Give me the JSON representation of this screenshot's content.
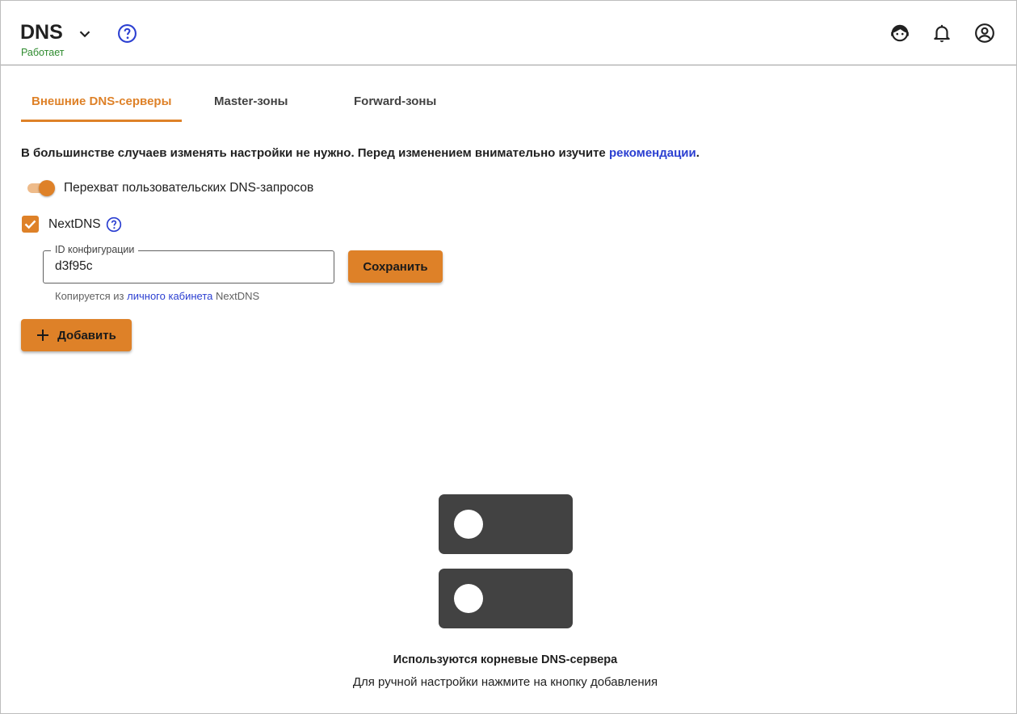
{
  "header": {
    "title": "DNS",
    "status": "Работает",
    "status_color": "#2e8b2e"
  },
  "tabs": [
    {
      "label": "Внешние DNS-серверы",
      "active": true
    },
    {
      "label": "Master-зоны",
      "active": false
    },
    {
      "label": "Forward-зоны",
      "active": false
    }
  ],
  "notice": {
    "text": "В большинстве случаев изменять настройки не нужно. Перед изменением внимательно изучите ",
    "link": "рекомендации",
    "end": "."
  },
  "intercept": {
    "label": "Перехват пользовательских DNS-запросов",
    "enabled": true
  },
  "nextdns": {
    "label": "NextDNS",
    "checked": true,
    "field_label": "ID конфигурации",
    "field_value": "d3f95c",
    "helper_prefix": "Копируется из ",
    "helper_link": "личного кабинета",
    "helper_suffix": " NextDNS",
    "save_label": "Сохранить"
  },
  "add_label": "Добавить",
  "empty_state": {
    "title": "Используются корневые DNS-сервера",
    "subtitle": "Для ручной настройки нажмите на кнопку добавления"
  },
  "icons": {
    "dropdown": "chevron-down-icon",
    "help": "help-circle-icon",
    "support": "support-agent-icon",
    "notifications": "bell-icon",
    "account": "account-circle-icon",
    "server": "server-icon"
  },
  "colors": {
    "accent": "#de8128",
    "link": "#2b3fd1",
    "help_icon": "#2b3fd1"
  }
}
